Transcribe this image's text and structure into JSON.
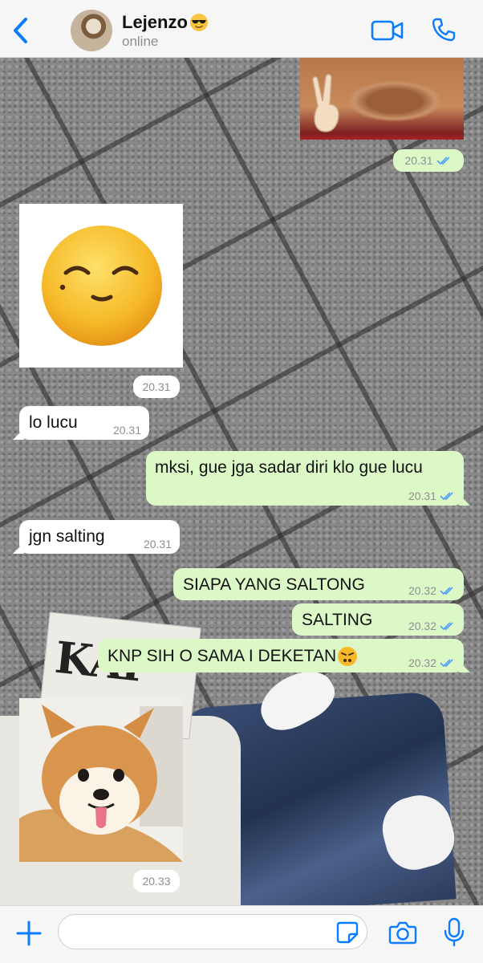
{
  "header": {
    "contact_name": "Lejenzo",
    "status": "online"
  },
  "messages": [
    {
      "type": "sticker",
      "direction": "out",
      "time": "20.31",
      "read": true,
      "sticker": "peace-hand-sticker"
    },
    {
      "type": "sticker",
      "direction": "in",
      "time": "20.31",
      "sticker": "relieved-face-sticker"
    },
    {
      "type": "text",
      "direction": "in",
      "text": "lo lucu",
      "time": "20.31"
    },
    {
      "type": "text",
      "direction": "out",
      "text": "mksi, gue jga sadar diri klo gue lucu",
      "time": "20.31",
      "read": true
    },
    {
      "type": "text",
      "direction": "in",
      "text": "jgn salting",
      "time": "20.31"
    },
    {
      "type": "text",
      "direction": "out",
      "text": "SIAPA YANG SALTONG",
      "time": "20.32",
      "read": true
    },
    {
      "type": "text",
      "direction": "out",
      "text": "SALTING",
      "time": "20.32",
      "read": true
    },
    {
      "type": "text",
      "direction": "out",
      "text": "KNP SIH O SAMA I DEKETAN",
      "emoji": "triumph-face",
      "time": "20.32",
      "read": true
    },
    {
      "type": "photo",
      "direction": "in",
      "time": "20.33",
      "subject": "shiba-dog-photo"
    }
  ],
  "background": {
    "newspaper_text": "KAI"
  },
  "composer": {
    "placeholder": ""
  },
  "colors": {
    "accent": "#0a7cff",
    "outgoing_bubble": "#dcf8c6",
    "incoming_bubble": "#ffffff",
    "read_ticks": "#4fa3f7"
  }
}
